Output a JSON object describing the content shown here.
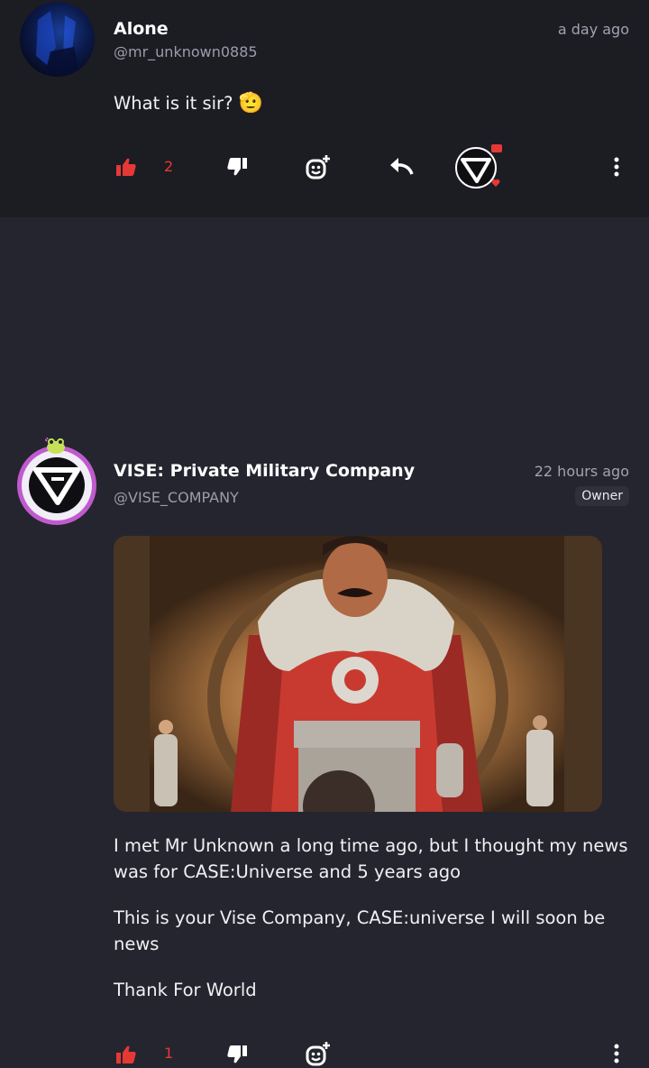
{
  "comments": [
    {
      "author_name": "Alone",
      "handle": "@mr_unknown0885",
      "time": "a day ago",
      "text": "What is it sir?",
      "emoji": "🫡",
      "like_count": "2",
      "icons": [
        "thumbs-up-icon",
        "thumbs-down-icon",
        "add-reaction-icon",
        "reply-icon",
        "vise-reaction-icon",
        "more-icon"
      ]
    },
    {
      "author_name": "VISE: Private Military Company",
      "handle": "@VISE_COMPANY",
      "time": "22 hours ago",
      "badge": "Owner",
      "paragraphs": [
        "I met Mr Unknown a long time ago, but I thought my news was for CASE:Universe and 5 years ago",
        "This is your Vise Company, CASE:universe I will soon be news",
        "Thank For World"
      ],
      "like_count": "1",
      "icons": [
        "thumbs-up-icon",
        "thumbs-down-icon",
        "add-reaction-icon",
        "more-icon"
      ]
    }
  ],
  "colors": {
    "accent_red": "#e53935",
    "bg_top": "#1c1c23",
    "bg_main": "#25252f",
    "muted_text": "#9c9cab",
    "avatar_ring": "#c05bcf"
  }
}
